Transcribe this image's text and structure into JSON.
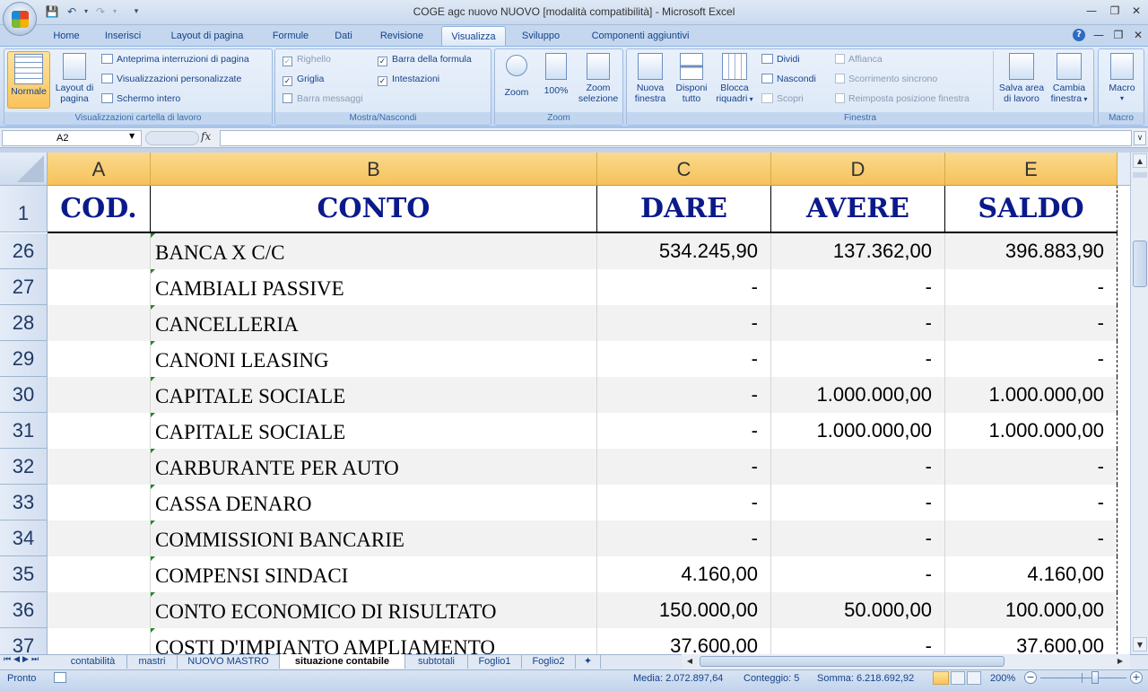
{
  "window": {
    "title": "COGE agc nuovo NUOVO  [modalità compatibilità] - Microsoft Excel",
    "minimize_icon": "minimize-icon",
    "restore_icon": "restore-icon",
    "close_icon": "close-icon"
  },
  "ribbon_tabs": [
    "Home",
    "Inserisci",
    "Layout di pagina",
    "Formule",
    "Dati",
    "Revisione",
    "Visualizza",
    "Sviluppo",
    "Componenti aggiuntivi"
  ],
  "active_tab": "Visualizza",
  "ribbon": {
    "views": {
      "normale": "Normale",
      "layout": "Layout di",
      "layout2": "pagina",
      "anteprima": "Anteprima interruzioni di pagina",
      "personalizzate": "Visualizzazioni personalizzate",
      "schermo": "Schermo intero",
      "label": "Visualizzazioni cartella di lavoro"
    },
    "show": {
      "righello": "Righello",
      "griglia": "Griglia",
      "barra_messaggi": "Barra messaggi",
      "barra_formula": "Barra della formula",
      "intestazioni": "Intestazioni",
      "label": "Mostra/Nascondi"
    },
    "zoom": {
      "zoom": "Zoom",
      "cento": "100%",
      "sel1": "Zoom",
      "sel2": "selezione",
      "label": "Zoom"
    },
    "window": {
      "nuova1": "Nuova",
      "nuova2": "finestra",
      "disponi1": "Disponi",
      "disponi2": "tutto",
      "blocca1": "Blocca",
      "blocca2": "riquadri",
      "dividi": "Dividi",
      "nascondi": "Nascondi",
      "scopri": "Scopri",
      "affianca": "Affianca",
      "scorrimento": "Scorrimento sincrono",
      "reimposta": "Reimposta posizione finestra",
      "salva1": "Salva area",
      "salva2": "di lavoro",
      "cambia1": "Cambia",
      "cambia2": "finestra",
      "label": "Finestra"
    },
    "macro": {
      "macro": "Macro",
      "label": "Macro"
    }
  },
  "formula_bar": {
    "name_box": "A2",
    "fx": "fx",
    "value": ""
  },
  "columns": [
    "A",
    "B",
    "C",
    "D",
    "E"
  ],
  "header_row": {
    "row_number": "1",
    "cells": [
      "COD.",
      "CONTO",
      "DARE",
      "AVERE",
      "SALDO"
    ]
  },
  "rows": [
    {
      "n": "26",
      "conto": "BANCA X C/C",
      "dare": "534.245,90",
      "avere": "137.362,00",
      "saldo": "396.883,90"
    },
    {
      "n": "27",
      "conto": "CAMBIALI PASSIVE",
      "dare": "-",
      "avere": "-",
      "saldo": "-"
    },
    {
      "n": "28",
      "conto": "CANCELLERIA",
      "dare": "-",
      "avere": "-",
      "saldo": "-"
    },
    {
      "n": "29",
      "conto": "CANONI LEASING",
      "dare": "-",
      "avere": "-",
      "saldo": "-"
    },
    {
      "n": "30",
      "conto": "CAPITALE SOCIALE",
      "dare": "-",
      "avere": "1.000.000,00",
      "saldo": "1.000.000,00"
    },
    {
      "n": "31",
      "conto": "CAPITALE SOCIALE",
      "dare": "-",
      "avere": "1.000.000,00",
      "saldo": "1.000.000,00"
    },
    {
      "n": "32",
      "conto": "CARBURANTE PER AUTO",
      "dare": "-",
      "avere": "-",
      "saldo": "-"
    },
    {
      "n": "33",
      "conto": "CASSA DENARO",
      "dare": "-",
      "avere": "-",
      "saldo": "-"
    },
    {
      "n": "34",
      "conto": "COMMISSIONI BANCARIE",
      "dare": "-",
      "avere": "-",
      "saldo": "-"
    },
    {
      "n": "35",
      "conto": "COMPENSI SINDACI",
      "dare": "4.160,00",
      "avere": "-",
      "saldo": "4.160,00"
    },
    {
      "n": "36",
      "conto": "CONTO ECONOMICO DI RISULTATO",
      "dare": "150.000,00",
      "avere": "50.000,00",
      "saldo": "100.000,00"
    },
    {
      "n": "37",
      "conto": "COSTI D'IMPIANTO AMPLIAMENTO",
      "dare": "37.600,00",
      "avere": "-",
      "saldo": "37.600,00"
    }
  ],
  "sheet_tabs": [
    "contabilità",
    "mastri",
    "NUOVO MASTRO",
    "situazione contabile",
    "subtotali",
    "Foglio1",
    "Foglio2"
  ],
  "active_sheet": "situazione contabile",
  "status": {
    "ready": "Pronto",
    "media": "Media:  2.072.897,64",
    "conteggio": "Conteggio: 5",
    "somma": "Somma:  6.218.692,92",
    "zoom": "200%"
  }
}
